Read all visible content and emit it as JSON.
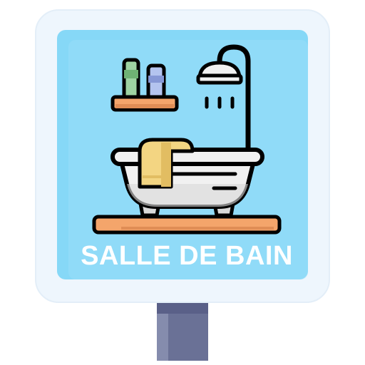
{
  "sign": {
    "caption": "SALLE DE BAIN"
  },
  "icons": {
    "sign": "bathroom-sign-icon",
    "post": "sign-post-icon",
    "shower": "shower-head-icon",
    "bathtub": "bathtub-icon",
    "shelf": "shelf-icon",
    "bottles": "toiletry-bottles-icon",
    "towel": "towel-icon"
  },
  "colors": {
    "frame": "#eef6fd",
    "panel": "#86d8f7",
    "panel_light": "#a4e3fa",
    "outline": "#000000",
    "wood": "#f4a56b",
    "wood_shadow": "#e08d55",
    "tub": "#f1f1f1",
    "tub_shadow": "#d8d8d8",
    "towel": "#f3d582",
    "towel_shadow": "#e2bd62",
    "bottle_green": "#9ed3a2",
    "bottle_blue": "#b4c4ef",
    "post": "#6a7196",
    "post_shade": "#858cad",
    "caption": "#ffffff"
  }
}
